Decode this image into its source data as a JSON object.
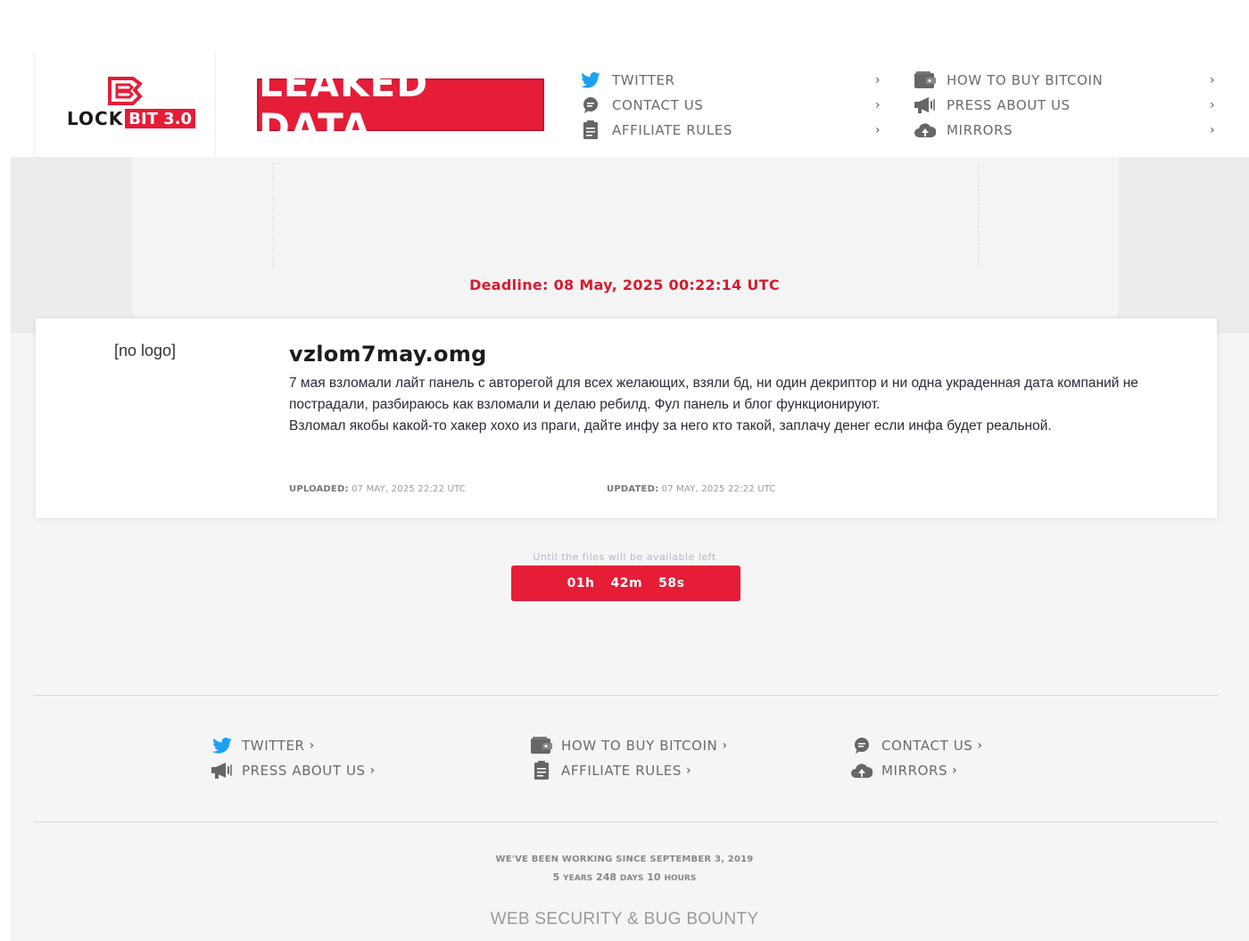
{
  "brand": {
    "logo_word": "LOCK",
    "logo_badge": "BIT 3.0",
    "banner": "LEAKED DATA",
    "accent_color": "#e51d37"
  },
  "nav": {
    "left": [
      {
        "label": "TWITTER",
        "icon": "twitter-icon"
      },
      {
        "label": "CONTACT US",
        "icon": "chat-icon"
      },
      {
        "label": "AFFILIATE RULES",
        "icon": "document-icon"
      }
    ],
    "right": [
      {
        "label": "HOW TO BUY BITCOIN",
        "icon": "wallet-icon"
      },
      {
        "label": "PRESS ABOUT US",
        "icon": "megaphone-icon"
      },
      {
        "label": "MIRRORS",
        "icon": "cloud-upload-icon"
      }
    ],
    "chevron": "›"
  },
  "deadline": "Deadline: 08 May, 2025 00:22:14 UTC",
  "post": {
    "logo_placeholder": "[no logo]",
    "title": "vzlom7may.omg",
    "description_line1": "7 мая взломали лайт панель с авторегой для всех желающих, взяли бд, ни один декриптор и ни одна украденная дата компаний не пострадали, разбираюсь как взломали и делаю ребилд. Фул панель и блог функционируют.",
    "description_line2": "Взломал якобы какой-то хакер хохо из праги, дайте инфу за него кто такой, заплачу денег если инфа будет реальной.",
    "uploaded_label": "UPLOADED:",
    "uploaded_value": "07 MAY, 2025 22:22 UTC",
    "updated_label": "UPDATED:",
    "updated_value": "07 MAY, 2025 22:22 UTC"
  },
  "countdown": {
    "caption": "Until the files will be available left",
    "hours": "01h",
    "minutes": "42m",
    "seconds": "58s"
  },
  "footer": {
    "col1": [
      {
        "label": "TWITTER",
        "icon": "twitter-icon"
      },
      {
        "label": "PRESS ABOUT US",
        "icon": "megaphone-icon"
      }
    ],
    "col2": [
      {
        "label": "HOW TO BUY BITCOIN",
        "icon": "wallet-icon"
      },
      {
        "label": "AFFILIATE RULES",
        "icon": "document-icon"
      }
    ],
    "col3": [
      {
        "label": "CONTACT US",
        "icon": "chat-icon"
      },
      {
        "label": "MIRRORS",
        "icon": "cloud-upload-icon"
      }
    ],
    "since": "WE'VE BEEN WORKING SINCE SEPTEMBER 3, 2019",
    "duration": {
      "years": "5",
      "years_label": "YEARS",
      "days": "248",
      "days_label": "DAYS",
      "hours": "10",
      "hours_label": "HOURS"
    },
    "tagline": "WEB SECURITY & BUG BOUNTY"
  }
}
